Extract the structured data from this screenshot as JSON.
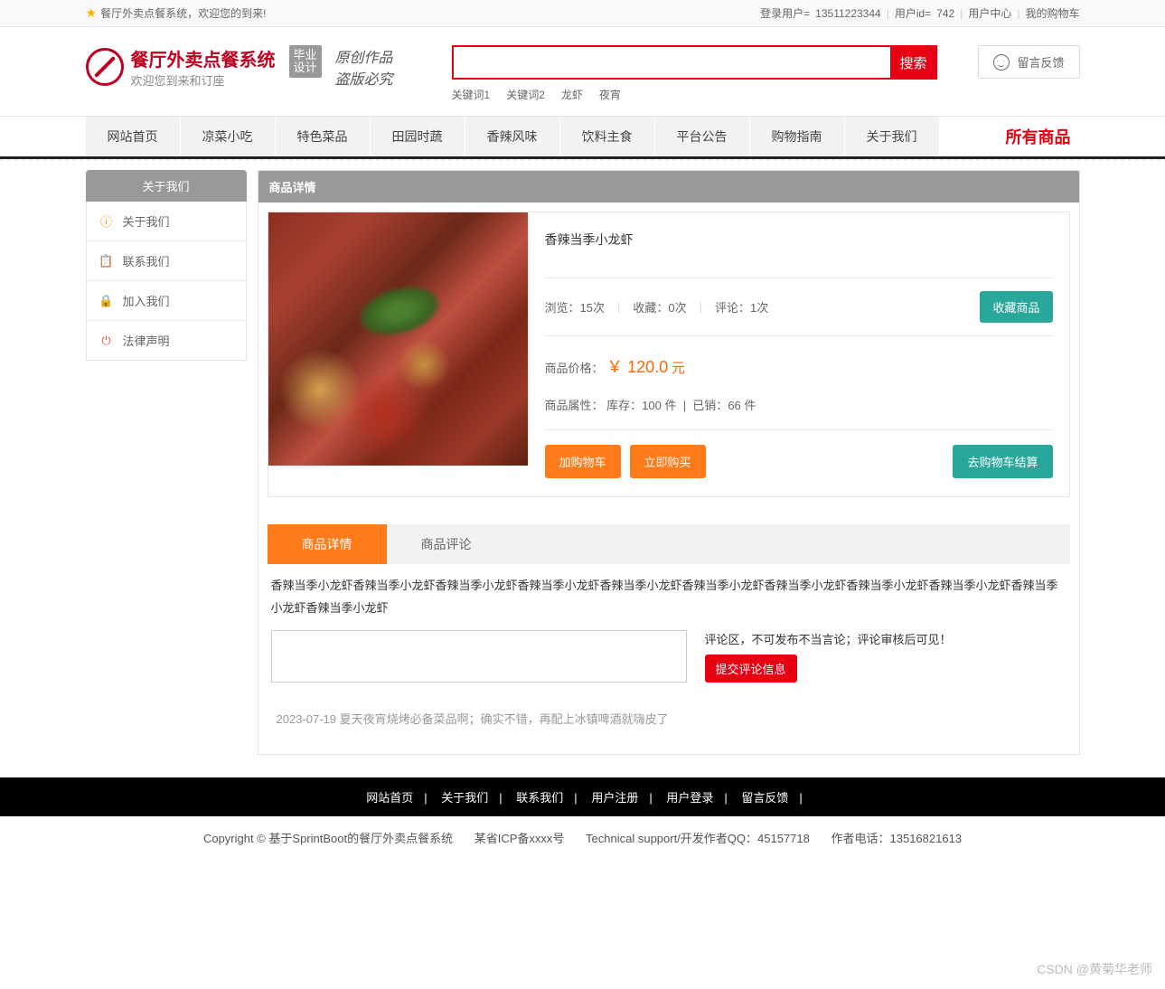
{
  "topbar": {
    "welcome": "餐厅外卖点餐系统，欢迎您的到来!",
    "login_user_label": "登录用户=",
    "login_user": "13511223344",
    "user_id_label": "用户id=",
    "user_id": "742",
    "user_center": "用户中心",
    "my_cart": "我的购物车"
  },
  "header": {
    "title": "餐厅外卖点餐系统",
    "subtitle": "欢迎您到来和订座",
    "badge1": "毕业",
    "badge2": "设计",
    "slogan1": "原创作品",
    "slogan2": "盗版必究",
    "search_btn": "搜索",
    "keywords": [
      "关键词1",
      "关键词2",
      "龙虾",
      "夜宵"
    ],
    "feedback": "留言反馈"
  },
  "nav": {
    "items": [
      "网站首页",
      "凉菜小吃",
      "特色菜品",
      "田园时蔬",
      "香辣风味",
      "饮料主食",
      "平台公告",
      "购物指南",
      "关于我们"
    ],
    "right": "所有商品"
  },
  "sidebar": {
    "title": "关于我们",
    "items": [
      {
        "icon": "ⓘ",
        "cls": "ic-orange",
        "label": "关于我们"
      },
      {
        "icon": "📋",
        "cls": "ic-blue",
        "label": "联系我们"
      },
      {
        "icon": "🔒",
        "cls": "ic-lock",
        "label": "加入我们"
      },
      {
        "icon": "⏻",
        "cls": "ic-power",
        "label": "法律声明"
      }
    ]
  },
  "content": {
    "header": "商品详情",
    "product_title": "香辣当季小龙虾",
    "views_label": "浏览：",
    "views": "15次",
    "fav_label": "收藏：",
    "fav": "0次",
    "comment_label": "评论：",
    "comment": "1次",
    "collect_btn": "收藏商品",
    "price_label": "商品价格：",
    "price_symbol": "￥",
    "price_value": "120.0",
    "price_unit": " 元",
    "attr_label": "商品属性：",
    "stock_label": "库存：",
    "stock": "100 件",
    "sold_label": "已销：",
    "sold": "66 件",
    "add_cart": "加购物车",
    "buy_now": "立即购买",
    "go_checkout": "去购物车结算",
    "tabs": [
      "商品详情",
      "商品评论"
    ],
    "description": "香辣当季小龙虾香辣当季小龙虾香辣当季小龙虾香辣当季小龙虾香辣当季小龙虾香辣当季小龙虾香辣当季小龙虾香辣当季小龙虾香辣当季小龙虾香辣当季小龙虾香辣当季小龙虾",
    "comment_hint": "评论区，不可发布不当言论；评论审核后可见！",
    "submit_comment": "提交评论信息",
    "existing_comment": "2023-07-19 夏天夜宵烧烤必备菜品啊；确实不错，再配上冰镇啤酒就嗨皮了"
  },
  "footer": {
    "links": [
      "网站首页",
      "关于我们",
      "联系我们",
      "用户注册",
      "用户登录",
      "留言反馈"
    ],
    "copyright": "Copyright © 基于SprintBoot的餐厅外卖点餐系统",
    "icp": "某省ICP备xxxx号",
    "tech": "Technical support/开发作者QQ：45157718",
    "phone": "作者电话：13516821613"
  },
  "watermark": "CSDN @黄菊华老师"
}
